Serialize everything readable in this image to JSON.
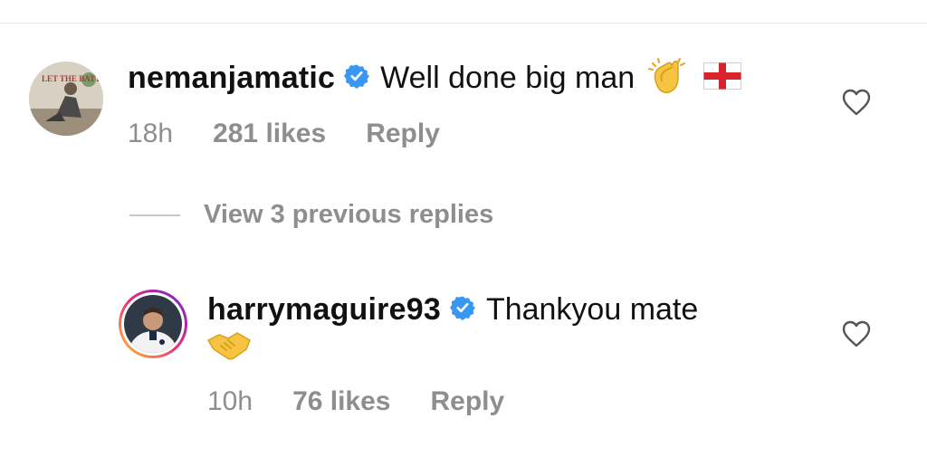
{
  "comments": [
    {
      "username": "nemanjamatic",
      "text": "Well done big man",
      "time": "18h",
      "likes": "281 likes",
      "reply_label": "Reply",
      "avatar_text": "LET THE BATTLE BEGIN"
    },
    {
      "username": "harrymaguire93",
      "text": "Thankyou mate",
      "time": "10h",
      "likes": "76 likes",
      "reply_label": "Reply"
    }
  ],
  "view_replies_label": "View 3 previous replies",
  "colors": {
    "verified": "#3897f0",
    "meta_text": "#8e8e8e",
    "story_ring_start": "#f9ce34",
    "story_ring_mid": "#ee2a7b",
    "story_ring_end": "#6228d7"
  },
  "icons": [
    "verified-badge-icon",
    "clapping-hands-emoji",
    "england-flag-emoji",
    "handshake-emoji",
    "heart-icon"
  ]
}
